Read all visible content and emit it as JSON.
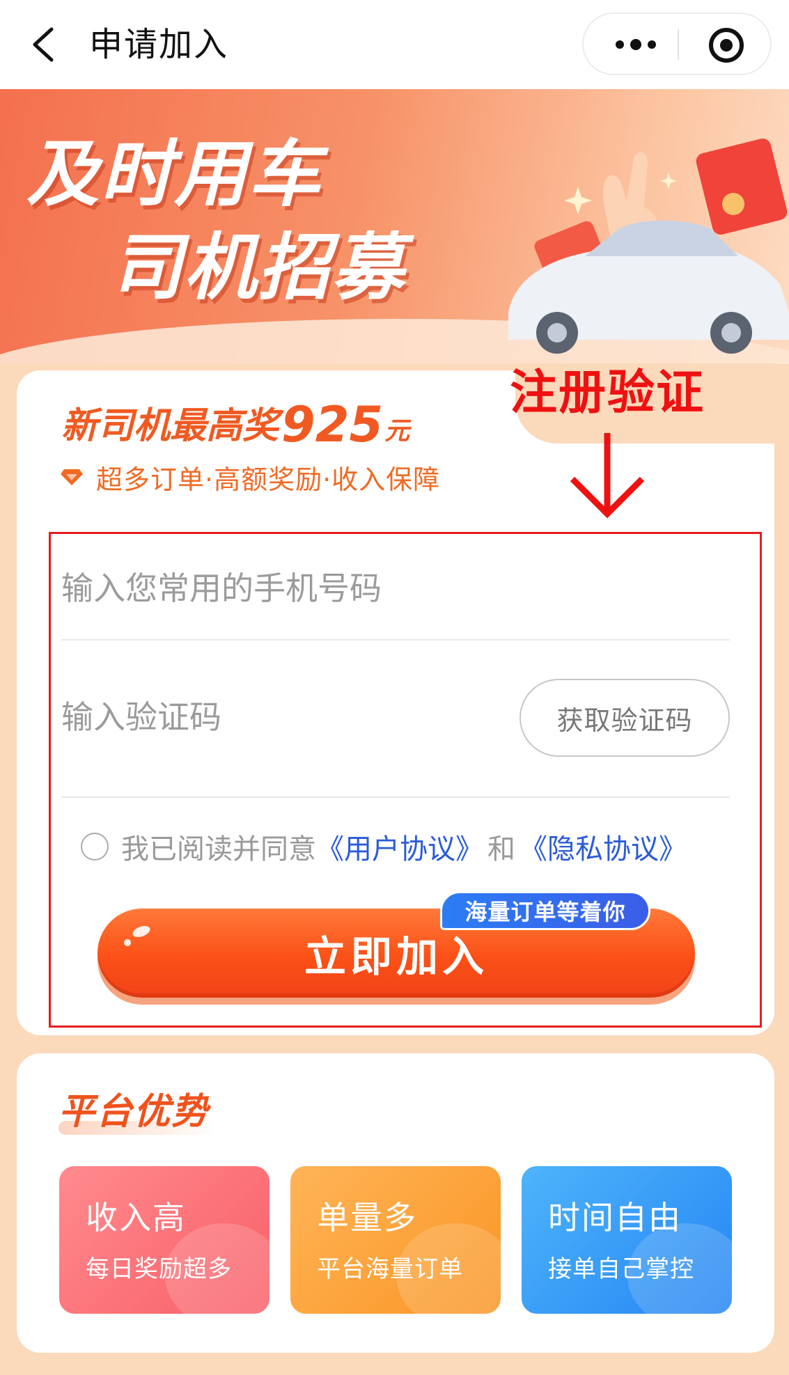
{
  "navbar": {
    "title": "申请加入",
    "back_icon": "chevron-left-icon",
    "more_icon": "more-dots-icon",
    "target_icon": "target-circle-icon"
  },
  "banner": {
    "title_line1": "及时用车",
    "title_line2": "司机招募"
  },
  "annotation": {
    "label": "注册验证",
    "color": "#ee1111"
  },
  "card": {
    "headline_text": "新司机最高奖",
    "headline_amount": "925",
    "headline_unit": "元",
    "subline": "超多订单·高额奖励·收入保障"
  },
  "form": {
    "phone_placeholder": "输入您常用的手机号码",
    "code_placeholder": "输入验证码",
    "get_code_label": "获取验证码",
    "agree_prefix": "我已阅读并同意",
    "user_agreement": "《用户协议》",
    "and_text": "和",
    "privacy_agreement": "《隐私协议》",
    "join_label": "立即加入",
    "join_badge": "海量订单等着你"
  },
  "platform": {
    "title": "平台优势",
    "features": [
      {
        "title": "收入高",
        "sub": "每日奖励超多"
      },
      {
        "title": "单量多",
        "sub": "平台海量订单"
      },
      {
        "title": "时间自由",
        "sub": "接单自己掌控"
      }
    ]
  },
  "colors": {
    "accent_orange": "#f05a22",
    "link_blue": "#2a5bd7",
    "page_bg": "#fbd9bb"
  }
}
